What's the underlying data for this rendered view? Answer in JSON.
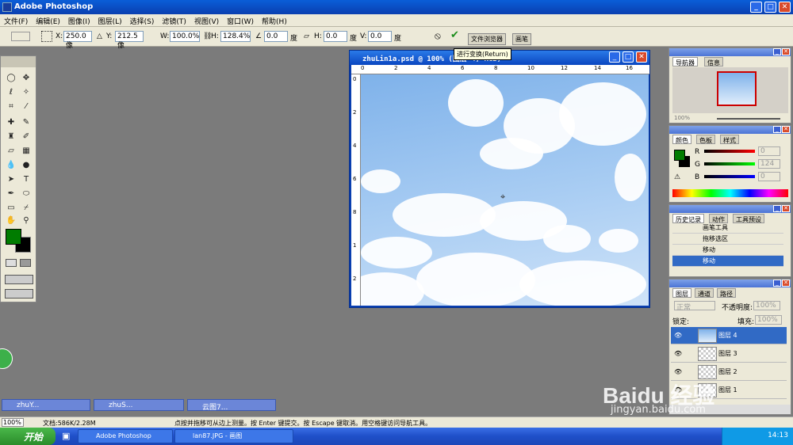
{
  "window": {
    "title": "Adobe Photoshop"
  },
  "menu": [
    "文件(F)",
    "编辑(E)",
    "图像(I)",
    "图层(L)",
    "选择(S)",
    "滤镜(T)",
    "视图(V)",
    "窗口(W)",
    "帮助(H)"
  ],
  "options": {
    "x_label": "X:",
    "x": "250.0 像",
    "y_label": "Y:",
    "y": "212.5 像",
    "w_label": "W:",
    "w": "100.0%",
    "h_label": "H:",
    "h": "128.4%",
    "angle": "0.0",
    "angle_unit": "度",
    "hskew_label": "H:",
    "hskew": "0.0",
    "hskew_unit": "度",
    "vskew_label": "V:",
    "vskew": "0.0",
    "vskew_unit": "度",
    "tabs": [
      "文件浏览器",
      "画笔"
    ],
    "tooltip": "进行变换(Return)"
  },
  "document": {
    "title": "zhuLin1a.psd @ 100% (图层 4, RGB)",
    "ruler_top": [
      "0",
      "2",
      "4",
      "6",
      "8",
      "10",
      "12",
      "14",
      "16"
    ],
    "ruler_left": [
      "0",
      "2",
      "4",
      "6",
      "8",
      "1",
      "2"
    ]
  },
  "navigator": {
    "tabs": [
      "导航器",
      "信息"
    ],
    "zoom": "100%"
  },
  "color": {
    "tabs": [
      "颜色",
      "色板",
      "样式"
    ],
    "r_label": "R",
    "r": "0",
    "g_label": "G",
    "g": "124",
    "b_label": "B",
    "b": "0",
    "fg": "#007c00"
  },
  "history": {
    "tabs": [
      "历史记录",
      "动作",
      "工具预设"
    ],
    "items": [
      "画笔工具",
      "拖移选区",
      "移动",
      "移动"
    ]
  },
  "layers": {
    "tabs": [
      "图层",
      "通道",
      "路径"
    ],
    "blend": "正常",
    "opacity_label": "不透明度:",
    "opacity": "100%",
    "lock_label": "锁定:",
    "fill_label": "填充:",
    "fill": "100%",
    "rows": [
      "图层 4",
      "图层 3",
      "图层 2",
      "图层 1"
    ]
  },
  "minimized": [
    "zhuY...",
    "zhuS...",
    "云图7..."
  ],
  "status": {
    "zoom": "100%",
    "doc": "文档:586K/2.28M",
    "hint": "点按并拖移可从边上测量。按 Enter 键提交。按 Escape 键取消。用空格键访问导航工具。"
  },
  "taskbar": {
    "start": "开始",
    "tasks": [
      "Adobe Photoshop",
      "lan87.JPG - 画图"
    ],
    "time": "14:13"
  },
  "watermark": {
    "brand": "Baidu 经验",
    "url": "jingyan.baidu.com"
  }
}
